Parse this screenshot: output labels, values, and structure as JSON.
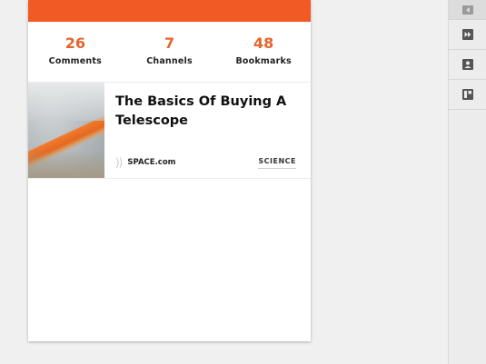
{
  "colors": {
    "accent": "#f15a24",
    "stat_value": "#e8632b"
  },
  "stats": [
    {
      "value": "26",
      "label": "Comments"
    },
    {
      "value": "7",
      "label": "Channels"
    },
    {
      "value": "48",
      "label": "Bookmarks"
    }
  ],
  "article": {
    "title": "The Basics Of Buying A Telescope",
    "source_icon": "))",
    "source": "SPACE.com",
    "category": "SCIENCE"
  },
  "rail": {
    "buttons": [
      {
        "icon": "collapse-panel-icon"
      },
      {
        "icon": "fast-forward-icon"
      },
      {
        "icon": "contact-card-icon"
      },
      {
        "icon": "panel-layout-icon"
      }
    ]
  }
}
